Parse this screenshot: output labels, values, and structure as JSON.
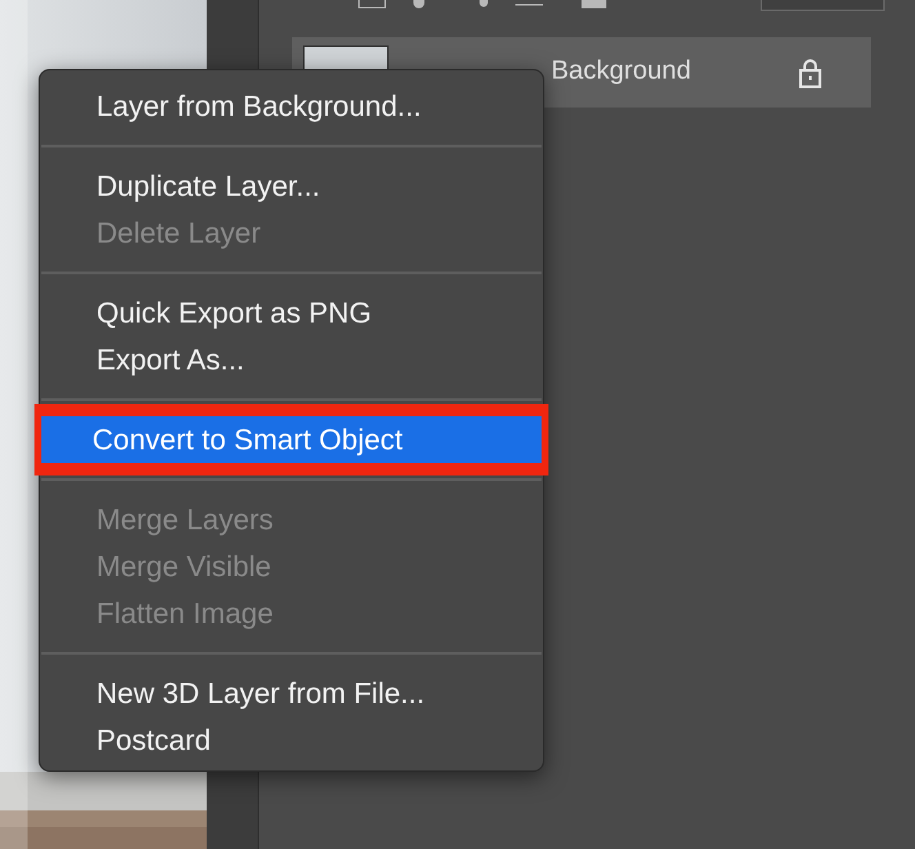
{
  "layers_panel": {
    "layers": [
      {
        "name": "Background",
        "locked": true,
        "selected": true
      }
    ]
  },
  "context_menu": {
    "groups": [
      {
        "items": [
          {
            "label": "Layer from Background...",
            "disabled": false,
            "selected": false
          }
        ]
      },
      {
        "items": [
          {
            "label": "Duplicate Layer...",
            "disabled": false,
            "selected": false
          },
          {
            "label": "Delete Layer",
            "disabled": true,
            "selected": false
          }
        ]
      },
      {
        "items": [
          {
            "label": "Quick Export as PNG",
            "disabled": false,
            "selected": false
          },
          {
            "label": "Export As...",
            "disabled": false,
            "selected": false
          }
        ]
      },
      {
        "items": [
          {
            "label": "Convert to Smart Object",
            "disabled": false,
            "selected": true
          }
        ]
      },
      {
        "items": [
          {
            "label": "Merge Layers",
            "disabled": true,
            "selected": false
          },
          {
            "label": "Merge Visible",
            "disabled": true,
            "selected": false
          },
          {
            "label": "Flatten Image",
            "disabled": true,
            "selected": false
          }
        ]
      },
      {
        "items": [
          {
            "label": "New 3D Layer from File...",
            "disabled": false,
            "selected": false
          },
          {
            "label": "Postcard",
            "disabled": false,
            "selected": false
          }
        ]
      }
    ]
  }
}
